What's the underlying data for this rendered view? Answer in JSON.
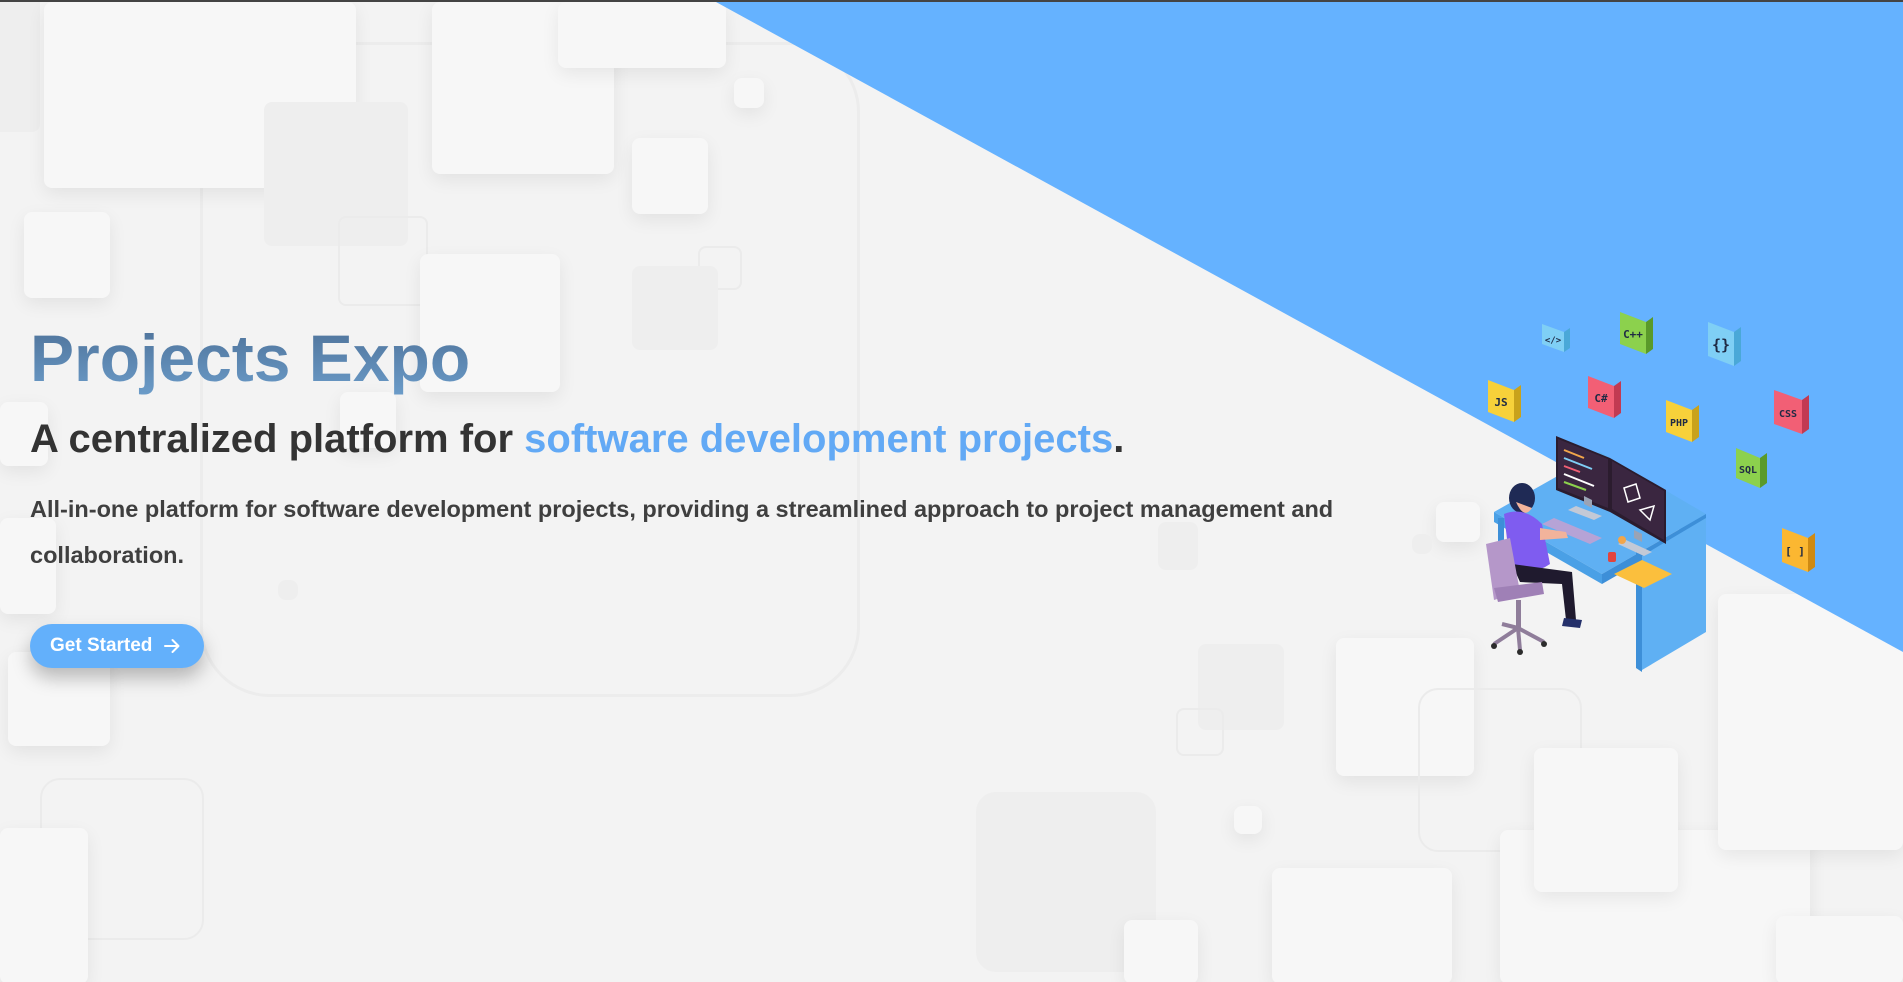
{
  "hero": {
    "title": "Projects Expo",
    "subtitle_prefix": "A centralized platform for ",
    "subtitle_accent": "software development projects",
    "subtitle_suffix": ".",
    "description": "All-in-one platform for software development projects, providing a streamlined approach to project management and collaboration.",
    "cta_label": "Get Started",
    "cta_icon": "arrow-right-icon"
  },
  "illustration": {
    "badges": [
      "</>",
      "C++",
      "{}",
      "JS",
      "C#",
      "PHP",
      "CSS",
      "SQL",
      "[ ]"
    ]
  },
  "colors": {
    "wedge": "#65b2ff",
    "accent": "#62a9f5",
    "title_gradient_top": "#4c6f96",
    "title_gradient_bottom": "#6b9cc9",
    "button": "#63b0fb",
    "background": "#f3f3f3"
  }
}
